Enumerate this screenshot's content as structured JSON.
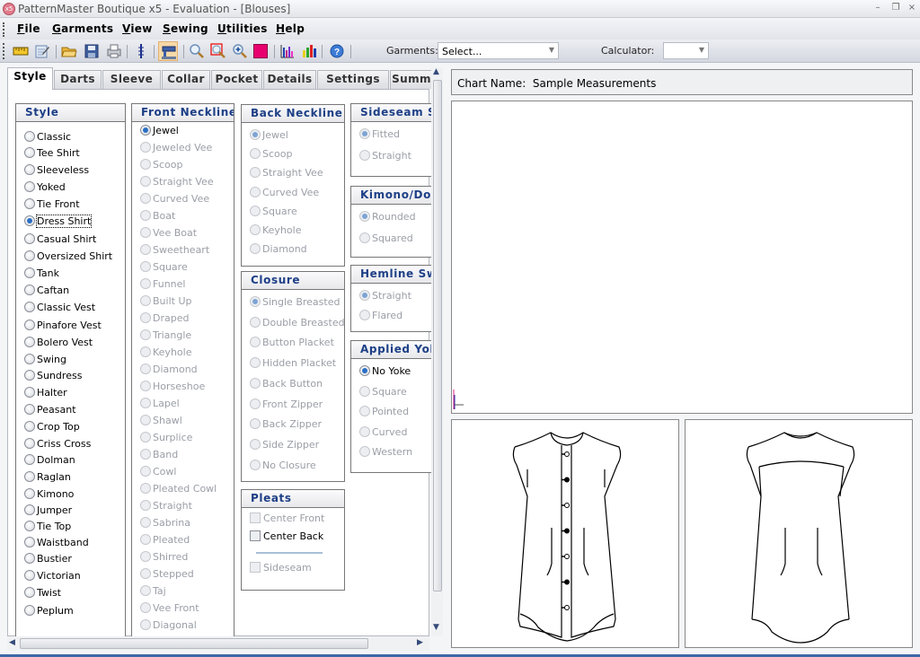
{
  "window": {
    "title": "PatternMaster Boutique x5 - Evaluation - [Blouses]",
    "app_icon_text": "x5",
    "controls": {
      "minimize": "–",
      "restore": "❐",
      "close": "×"
    }
  },
  "menu": [
    {
      "label": "File",
      "accel": "F",
      "rest": "ile"
    },
    {
      "label": "Garments",
      "accel": "G",
      "rest": "arments"
    },
    {
      "label": "View",
      "accel": "V",
      "rest": "iew"
    },
    {
      "label": "Sewing",
      "accel": "S",
      "rest": "ewing"
    },
    {
      "label": "Utilities",
      "accel": "U",
      "rest": "tilities"
    },
    {
      "label": "Help",
      "accel": "H",
      "rest": "elp"
    }
  ],
  "toolbar": {
    "icons": [
      "ruler-icon",
      "edit-chart-icon",
      "open-folder-icon",
      "save-icon",
      "print-icon",
      "needle-icon",
      "sewing-machine-icon",
      "zoom-icon",
      "zoom-window-icon",
      "zoom-in-icon",
      "color-swatch-icon",
      "bar-chart-icon",
      "bar-chart-color-icon",
      "help-icon"
    ],
    "color_swatch": "#e8006f",
    "garments_label": "Garments:",
    "garments_value": "Select...",
    "calculator_label": "Calculator:",
    "calculator_value": ""
  },
  "tabs": [
    "Style",
    "Darts",
    "Sleeve",
    "Collar",
    "Pocket",
    "Details",
    "Settings",
    "Summ"
  ],
  "active_tab": "Style",
  "groups": {
    "style": {
      "title": "Style",
      "selected": "Dress Shirt",
      "options": [
        "Classic",
        "Tee Shirt",
        "Sleeveless",
        "Yoked",
        "Tie Front",
        "Dress Shirt",
        "Casual Shirt",
        "Oversized Shirt",
        "Tank",
        "Caftan",
        "Classic Vest",
        "Pinafore Vest",
        "Bolero Vest",
        "Swing",
        "Sundress",
        "Halter",
        "Peasant",
        "Crop Top",
        "Criss Cross",
        "Dolman",
        "Raglan",
        "Kimono",
        "Jumper",
        "Tie Top",
        "Waistband",
        "Bustier",
        "Victorian",
        "Twist",
        "Peplum"
      ]
    },
    "front_neckline": {
      "title": "Front Neckline",
      "selected": "Jewel",
      "options": [
        "Jewel",
        "Jeweled Vee",
        "Scoop",
        "Straight Vee",
        "Curved Vee",
        "Boat",
        "Vee Boat",
        "Sweetheart",
        "Square",
        "Funnel",
        "Built Up",
        "Draped",
        "Triangle",
        "Keyhole",
        "Diamond",
        "Horseshoe",
        "Lapel",
        "Shawl",
        "Surplice",
        "Band",
        "Cowl",
        "Pleated Cowl",
        "Straight",
        "Sabrina",
        "Pleated",
        "Shirred",
        "Stepped",
        "Taj",
        "Vee Front",
        "Diagonal"
      ]
    },
    "back_neckline": {
      "title": "Back Neckline",
      "selected": "Jewel",
      "options": [
        "Jewel",
        "Scoop",
        "Straight Vee",
        "Curved Vee",
        "Square",
        "Keyhole",
        "Diamond"
      ]
    },
    "closure": {
      "title": "Closure",
      "selected": "Single Breasted",
      "options": [
        "Single Breasted",
        "Double Breasted",
        "Button Placket",
        "Hidden Placket",
        "Back Button",
        "Front Zipper",
        "Back Zipper",
        "Side Zipper",
        "No Closure"
      ]
    },
    "pleats": {
      "title": "Pleats",
      "options": [
        {
          "label": "Center Front",
          "checked": false,
          "enabled": false
        },
        {
          "label": "Center Back",
          "checked": false,
          "enabled": true
        },
        {
          "label": "Sideseam",
          "checked": false,
          "enabled": false
        }
      ]
    },
    "sideseam": {
      "title": "Sideseam S",
      "selected": "Fitted",
      "options": [
        "Fitted",
        "Straight"
      ]
    },
    "kimono": {
      "title": "Kimono/Do",
      "selected": "Rounded",
      "options": [
        "Rounded",
        "Squared"
      ]
    },
    "hemline": {
      "title": "Hemline Sw",
      "selected": "Straight",
      "options": [
        "Straight",
        "Flared"
      ]
    },
    "applied_yoke": {
      "title": "Applied Yok",
      "selected": "No Yoke",
      "options": [
        "No Yoke",
        "Square",
        "Pointed",
        "Curved",
        "Western"
      ]
    }
  },
  "chart": {
    "label": "Chart Name:",
    "name": "Sample Measurements"
  },
  "preview": {
    "front_buttons": 7
  }
}
